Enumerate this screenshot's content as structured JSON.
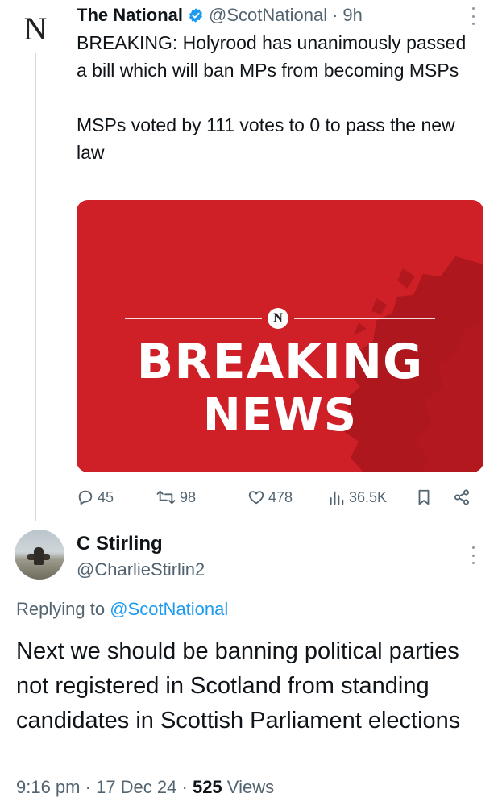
{
  "tweet": {
    "avatar_letter": "N",
    "display_name": "The National",
    "handle": "@ScotNational",
    "separator": "·",
    "time_ago": "9h",
    "text_lines": [
      "BREAKING: Holyrood has unanimously passed a bill which will ban MPs from becoming MSPs",
      "MSPs voted by 111 votes to 0 to pass the new law"
    ],
    "media": {
      "logo_letter": "N",
      "headline_line1": "BREAKING",
      "headline_line2": "NEWS",
      "background_color": "#cf2027"
    },
    "actions": {
      "replies": "45",
      "retweets": "98",
      "likes": "478",
      "views": "36.5K"
    },
    "icons": [
      "more-icon",
      "verified-icon",
      "reply-icon",
      "retweet-icon",
      "like-icon",
      "views-icon",
      "bookmark-icon",
      "share-icon"
    ],
    "verified_color": "#1d9bf0"
  },
  "reply": {
    "display_name": "C Stirling",
    "handle": "@CharlieStirlin2",
    "replying_prefix": "Replying to",
    "replying_to": "@ScotNational",
    "text": "Next we should be banning political parties not registered in Scotland from standing candidates in Scottish Parliament elections",
    "time": "9:16 pm",
    "separator": "·",
    "date": "17 Dec 24",
    "views_count": "525",
    "views_label": "Views"
  },
  "colors": {
    "text": "#0f1419",
    "muted": "#536471",
    "link": "#1d9bf0"
  }
}
